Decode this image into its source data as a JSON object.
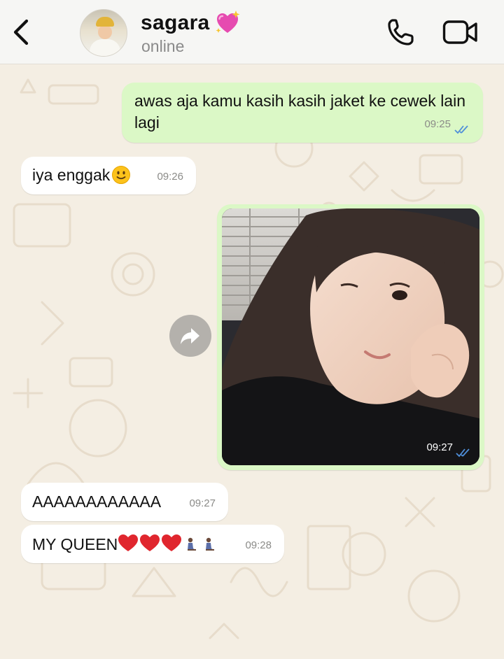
{
  "header": {
    "back_icon": "chevron-left-icon",
    "contact_name": "sagara",
    "contact_emoji": "sparkling-heart",
    "status": "online",
    "call_icon": "phone-icon",
    "video_icon": "video-camera-icon"
  },
  "messages": [
    {
      "direction": "outgoing",
      "text": "awas aja kamu kasih kasih jaket ke cewek lain lagi",
      "time": "09:25",
      "read": true
    },
    {
      "direction": "incoming",
      "text": "iya enggak",
      "emoji": "slightly-smiling-face",
      "time": "09:26"
    },
    {
      "direction": "outgoing",
      "type": "image",
      "time": "09:27",
      "read": true
    },
    {
      "direction": "incoming",
      "text": "AAAAAAAAAAAA",
      "time": "09:27"
    },
    {
      "direction": "incoming",
      "text": "MY QUEEN",
      "emoji": "hearts-and-kneeling-people",
      "time": "09:28"
    }
  ],
  "colors": {
    "outgoing_bubble": "#dbf8c6",
    "incoming_bubble": "#ffffff",
    "read_ticks": "#4f8fd9",
    "wallpaper": "#f4eee3"
  }
}
